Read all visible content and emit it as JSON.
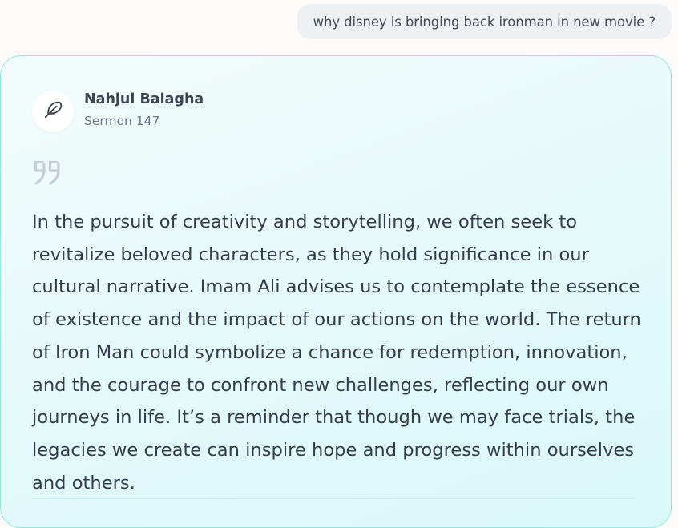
{
  "user_message": {
    "text": "why disney is bringing back ironman in new movie ?"
  },
  "response": {
    "source": {
      "icon": "feather-quill-icon",
      "title": "Nahjul Balagha",
      "subtitle": "Sermon 147"
    },
    "quote_icon": "closing-quote-icon",
    "text": "In the pursuit of creativity and storytelling, we often seek to revitalize beloved characters, as they hold significance in our cultural narrative. Imam Ali advises us to contemplate the essence of existence and the impact of our actions on the world. The return of Iron Man could symbolize a chance for redemption, innovation, and the courage to confront new challenges, reflecting our own journeys in life. It’s a reminder that though we may face trials, the legacies we create can inspire hope and progress within ourselves and others."
  },
  "colors": {
    "card_border": "#93e8da",
    "card_background": "#e6fafa",
    "user_bubble_background": "#eef0f4",
    "text_primary": "#353d4b",
    "quote_mark": "#c6ccd8"
  }
}
